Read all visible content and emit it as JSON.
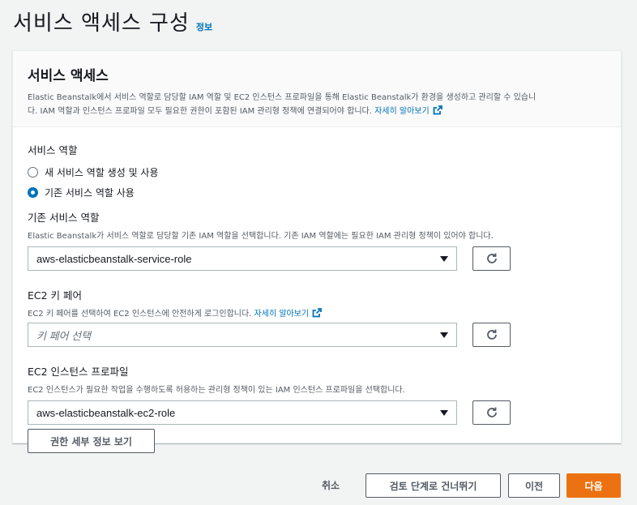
{
  "page": {
    "title": "서비스 액세스 구성",
    "info_label": "정보"
  },
  "panel": {
    "title": "서비스 액세스",
    "desc_line1": "Elastic Beanstalk에서 서비스 역할로 담당할 IAM 역할 및 EC2 인스턴스 프로파일을 통해 Elastic Beanstalk가 환경을 생성하고 관리할 수 있습니",
    "desc_line2": "다. IAM 역할과 인스턴스 프로파일 모두 필요한 권한이 포함된 IAM 관리형 정책에 연결되어야 합니다.",
    "learn_more": "자세히 알아보기"
  },
  "service_role": {
    "label": "서비스 역할",
    "options": [
      {
        "label": "새 서비스 역할 생성 및 사용",
        "checked": false
      },
      {
        "label": "기존 서비스 역할 사용",
        "checked": true
      }
    ]
  },
  "existing_role": {
    "label": "기존 서비스 역할",
    "desc": "Elastic Beanstalk가 서비스 역할로 담당할 기존 IAM 역할을 선택합니다. 기존 IAM 역할에는 필요한 IAM 관리형 정책이 있어야 합니다.",
    "value": "aws-elasticbeanstalk-service-role"
  },
  "key_pair": {
    "label": "EC2 키 페어",
    "desc": "EC2 키 페어를 선택하여 EC2 인스턴스에 안전하게 로그인합니다.",
    "learn_more": "자세히 알아보기",
    "placeholder": "키 페어 선택"
  },
  "instance_profile": {
    "label": "EC2 인스턴스 프로파일",
    "desc": "EC2 인스턴스가 필요한 작업을 수행하도록 허용하는 관리형 정책이 있는 IAM 인스턴스 프로파일을 선택합니다.",
    "value": "aws-elasticbeanstalk-ec2-role",
    "details_button": "권한 세부 정보 보기"
  },
  "footer": {
    "cancel": "취소",
    "skip": "검토 단계로 건너뛰기",
    "prev": "이전",
    "next": "다음"
  },
  "colors": {
    "link": "#0073bb",
    "primary": "#ec7211"
  }
}
